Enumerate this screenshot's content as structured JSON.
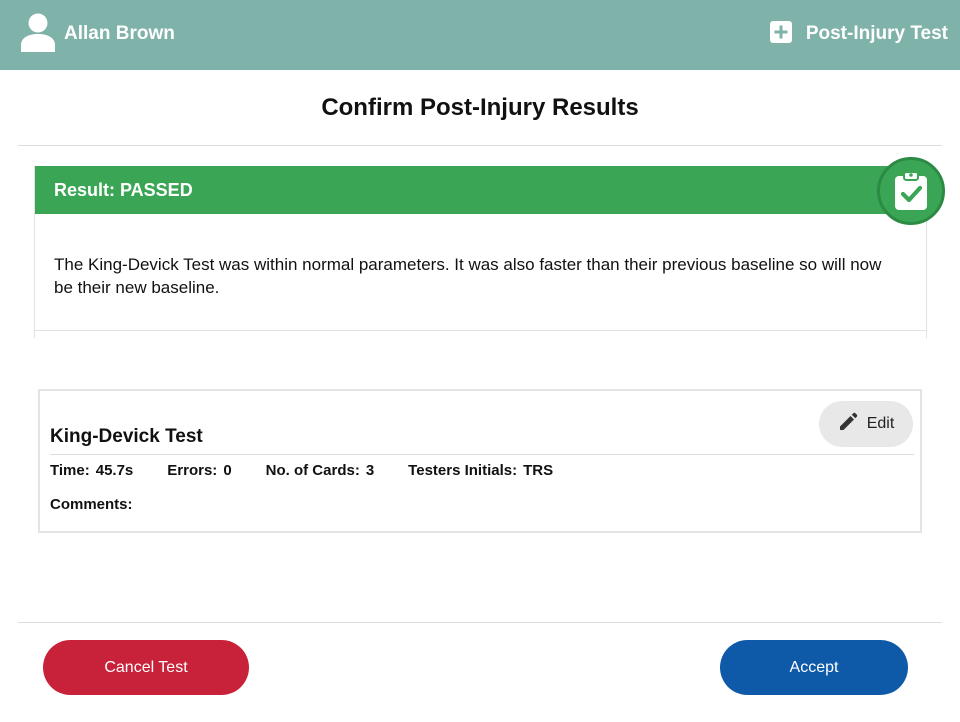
{
  "header": {
    "user_name": "Allan Brown",
    "user_icon": "user-icon",
    "mode_label": "Post-Injury Test",
    "mode_icon": "plus-square-icon",
    "bg_color": "#7fb2a9"
  },
  "page": {
    "title": "Confirm Post-Injury Results"
  },
  "result": {
    "label": "Result: PASSED",
    "status_color": "#3aa655",
    "badge_icon": "clipboard-check-icon",
    "message": "The King-Devick Test was within normal parameters.  It was also faster than their previous baseline so will now be their new baseline."
  },
  "test": {
    "title": "King-Devick Test",
    "edit_label": "Edit",
    "edit_icon": "pencil-icon",
    "time_label": "Time:",
    "time_value": "45.7s",
    "errors_label": "Errors:",
    "errors_value": "0",
    "cards_label": "No. of Cards:",
    "cards_value": "3",
    "initials_label": "Testers Initials:",
    "initials_value": "TRS",
    "comments_label": "Comments:"
  },
  "actions": {
    "cancel_label": "Cancel Test",
    "cancel_color": "#c8223a",
    "accept_label": "Accept",
    "accept_color": "#0e59a8"
  }
}
